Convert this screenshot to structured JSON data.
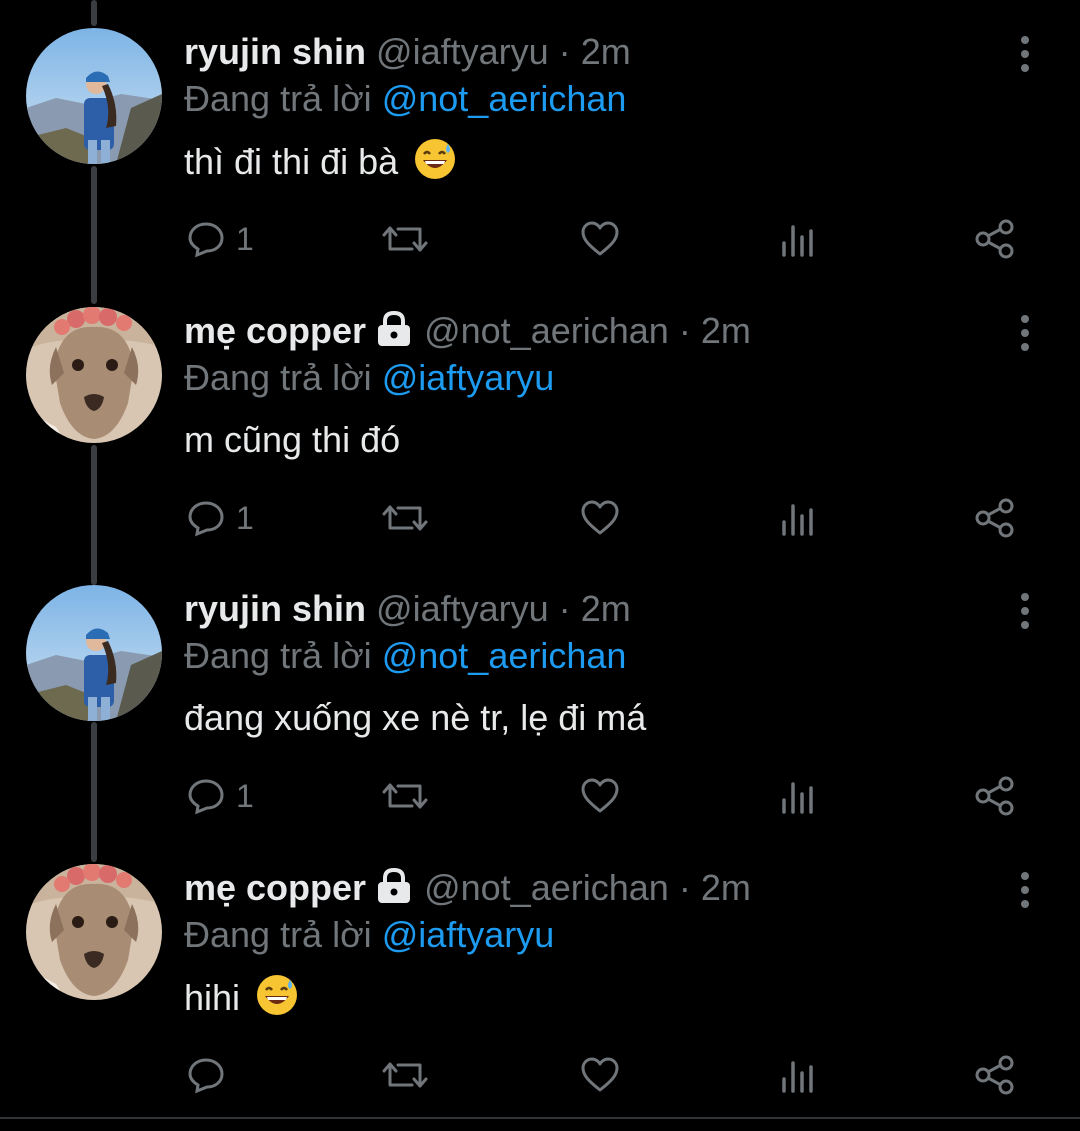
{
  "reply_prefix": "Đang trả lời",
  "colors": {
    "background": "#000000",
    "text": "#e7e9ea",
    "muted": "#71767b",
    "link": "#1d9bf0"
  },
  "icons": {
    "reply": "reply-bubble-icon",
    "retweet": "retweet-icon",
    "like": "heart-icon",
    "views": "views-bars-icon",
    "share": "share-icon",
    "more": "more-vertical-icon",
    "lock": "lock-icon"
  },
  "tweets": [
    {
      "name": "ryujin shin",
      "handle": "@iaftyaryu",
      "sep": "·",
      "time": "2m",
      "reply_to": "@not_aerichan",
      "text": "thì đi thi đi bà",
      "emoji": "sweat-smile-emoji",
      "replies": "1",
      "avatar": "hiker-photo",
      "locked": false
    },
    {
      "name": "mẹ copper",
      "handle": "@not_aerichan",
      "sep": "·",
      "time": "2m",
      "reply_to": "@iaftyaryu",
      "text": "m cũng thi đó",
      "emoji": "",
      "replies": "1",
      "avatar": "dog-photo",
      "locked": true
    },
    {
      "name": "ryujin shin",
      "handle": "@iaftyaryu",
      "sep": "·",
      "time": "2m",
      "reply_to": "@not_aerichan",
      "text": "đang xuống xe nè tr, lẹ đi má",
      "emoji": "",
      "replies": "1",
      "avatar": "hiker-photo",
      "locked": false
    },
    {
      "name": "mẹ copper",
      "handle": "@not_aerichan",
      "sep": "·",
      "time": "2m",
      "reply_to": "@iaftyaryu",
      "text": "hihi",
      "emoji": "sweat-smile-emoji",
      "replies": "",
      "avatar": "dog-photo",
      "locked": true
    }
  ]
}
